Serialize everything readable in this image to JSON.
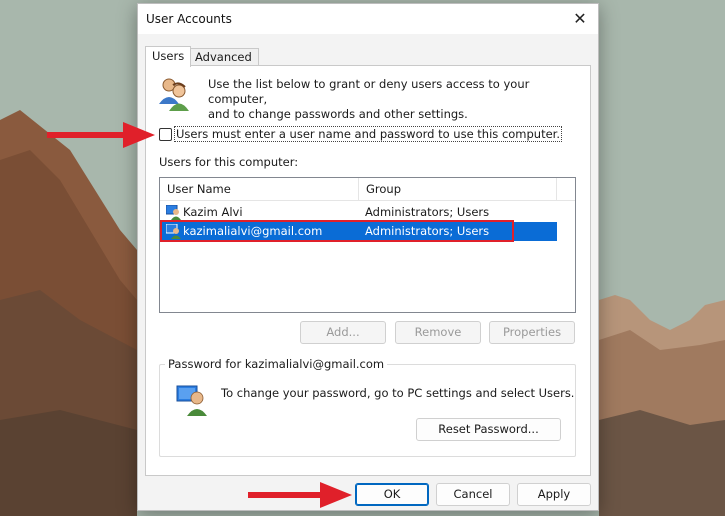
{
  "window": {
    "title": "User Accounts"
  },
  "tabs": [
    {
      "label": "Users",
      "active": true
    },
    {
      "label": "Advanced",
      "active": false
    }
  ],
  "intro": {
    "line1": "Use the list below to grant or deny users access to your computer,",
    "line2": "and to change passwords and other settings."
  },
  "checkbox": {
    "label": "Users must enter a user name and password to use this computer.",
    "checked": false
  },
  "users_section": {
    "label": "Users for this computer:",
    "columns": [
      "User Name",
      "Group"
    ],
    "rows": [
      {
        "name": "Kazim Alvi",
        "group": "Administrators; Users",
        "selected": false
      },
      {
        "name": "kazimalialvi@gmail.com",
        "group": "Administrators; Users",
        "selected": true
      }
    ]
  },
  "list_buttons": {
    "add": "Add...",
    "remove": "Remove",
    "properties": "Properties"
  },
  "password_group": {
    "title": "Password for kazimalialvi@gmail.com",
    "text": "To change your password, go to PC settings and select Users.",
    "reset_button": "Reset Password..."
  },
  "footer_buttons": {
    "ok": "OK",
    "cancel": "Cancel",
    "apply": "Apply"
  },
  "colors": {
    "selection": "#0a6cd6",
    "annotation": "#e0202a",
    "focus": "#0067c0"
  },
  "icons": [
    "users-icon",
    "user-icon",
    "password-user-icon",
    "close-icon",
    "arrow-annotation-icon"
  ]
}
